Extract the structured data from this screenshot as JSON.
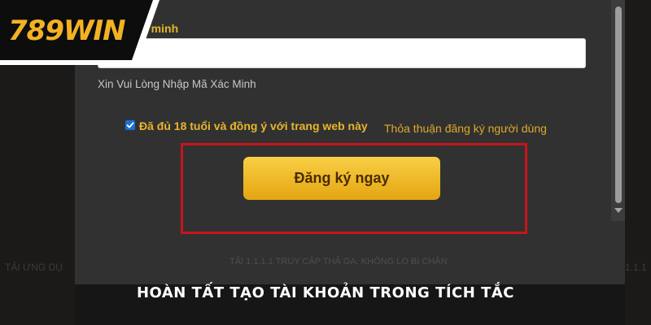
{
  "brand": {
    "logo_text": "789WIN"
  },
  "form": {
    "field_label": "c minh",
    "code_input": {
      "value": "",
      "placeholder": ""
    },
    "hint": "Xin Vui Lòng Nhập Mã Xác Minh",
    "agree": {
      "checked": true,
      "label": "Đã đủ 18 tuổi và đồng ý với trang web này"
    },
    "terms_link": "Thỏa thuận đăng ký người dùng",
    "register_label": "Đăng ký ngay",
    "promo_text": "TẢI 1.1.1.1 TRUY CẬP THẢ GA, KHÔNG LO BỊ CHẶN"
  },
  "side": {
    "left_text": "TẢI ỨNG DỤ",
    "right_text": "1.1.1"
  },
  "caption": "HOÀN TẤT TẠO TÀI KHOẢN TRONG TÍCH TẮC",
  "colors": {
    "accent_gold": "#e8b52c",
    "button_gold": "#f2bd2e",
    "highlight_red": "#c8141b",
    "panel_bg": "#313131",
    "page_bg": "#161616",
    "checkbox_blue": "#1d6fd8"
  }
}
